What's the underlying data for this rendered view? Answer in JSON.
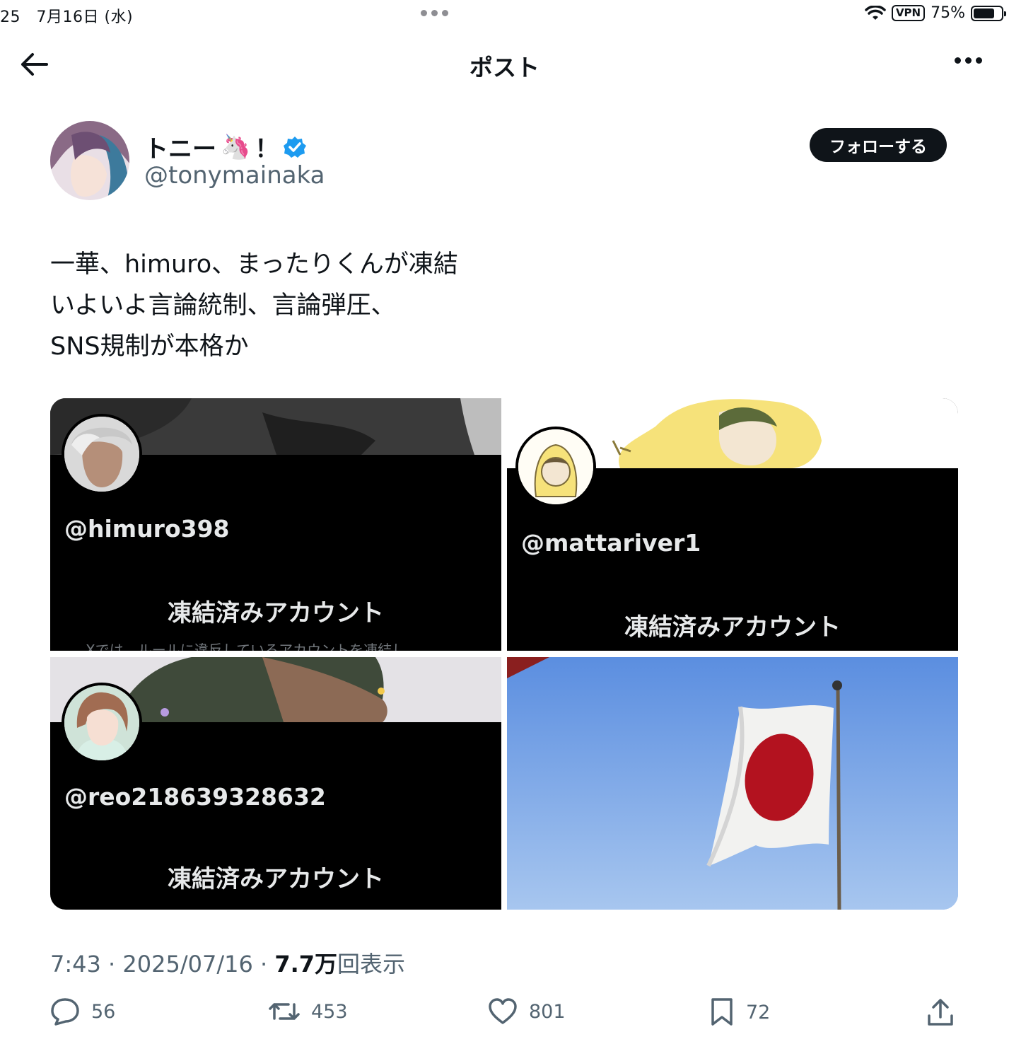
{
  "status_bar": {
    "time": "25　7月16日 (水)",
    "vpn": "VPN",
    "battery": "75%",
    "battery_level": 0.75
  },
  "nav": {
    "title": "ポスト"
  },
  "author": {
    "display_name": "トニー",
    "emoji": "🦄",
    "suffix": "！",
    "handle": "@tonymainaka",
    "follow_label": "フォローする"
  },
  "post": {
    "lines": [
      "一華、himuro、まったりくんが凍結",
      "いよいよ言論統制、言論弾圧、",
      "SNS規制が本格か"
    ]
  },
  "media": [
    {
      "handle": "@himuro398",
      "label": "凍結済みアカウント",
      "subtext": "Xでは、ルールに違反しているアカウントを凍結し"
    },
    {
      "handle": "@mattariver1",
      "label": "凍結済みアカウント"
    },
    {
      "handle": "@reo218639328632",
      "label": "凍結済みアカウント"
    }
  ],
  "meta": {
    "time": "7:43",
    "sep": " · ",
    "date": "2025/07/16",
    "views_count": "7.7万",
    "views_label": "回表示"
  },
  "actions": {
    "replies": "56",
    "reposts": "453",
    "likes": "801",
    "bookmarks": "72"
  },
  "colors": {
    "text": "#0f1419",
    "secondary": "#536471",
    "verified": "#1d9bf0",
    "sky": "#6d9ee6",
    "flag_red": "#b3121f"
  }
}
